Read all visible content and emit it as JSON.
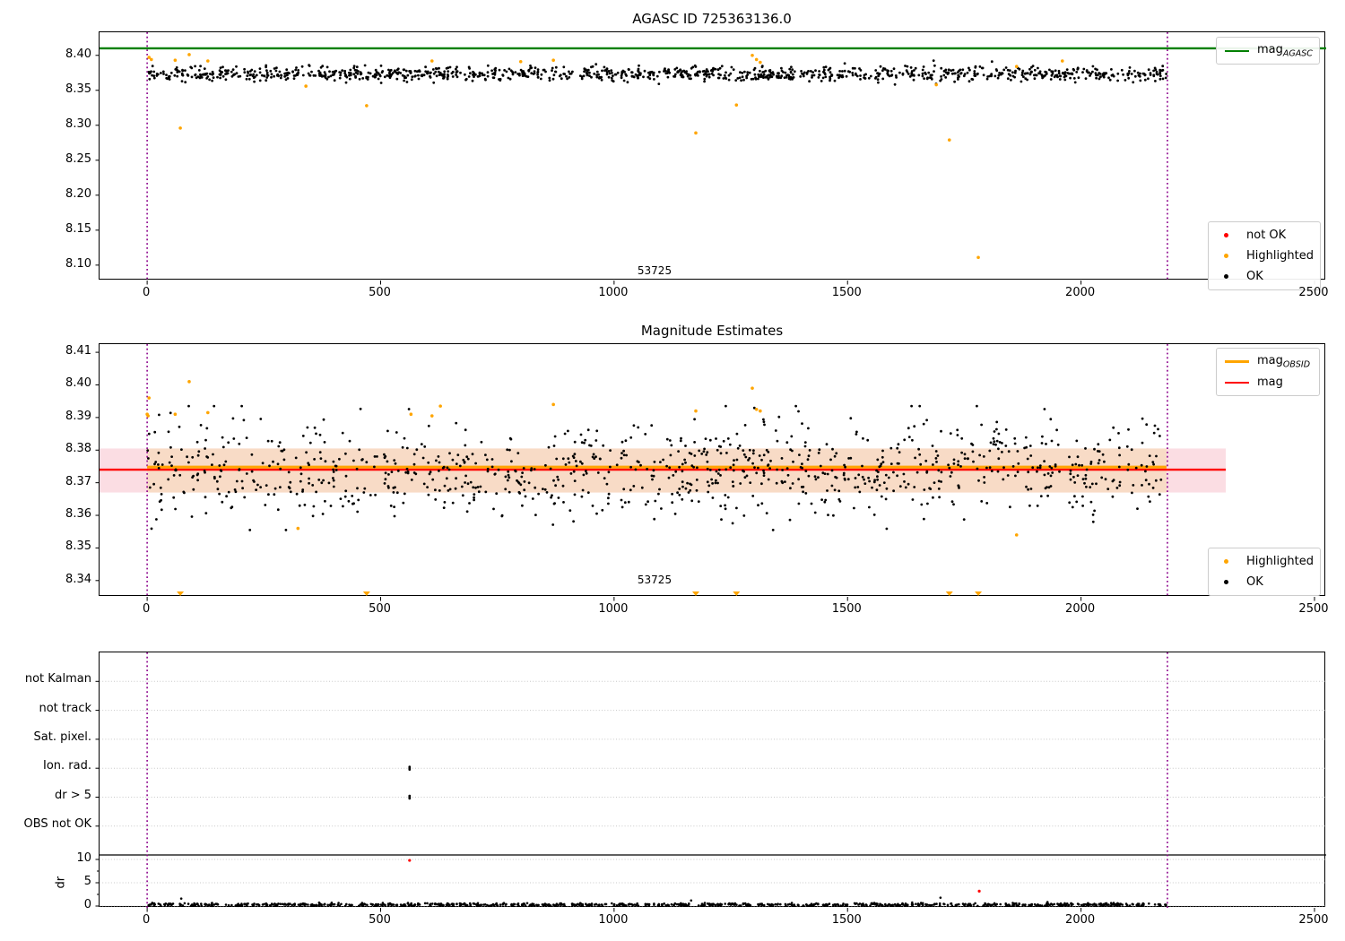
{
  "chart_data": [
    {
      "type": "scatter",
      "title": "AGASC ID 725363136.0",
      "xlim": [
        -102,
        2525
      ],
      "ylim": [
        8.078,
        8.433
      ],
      "xticks": [
        0,
        500,
        1000,
        1500,
        2000,
        2500
      ],
      "yticks": [
        "8.10",
        "8.15",
        "8.20",
        "8.25",
        "8.30",
        "8.35",
        "8.40"
      ],
      "grid": false,
      "agasc_line": {
        "value": 8.41,
        "color": "#008000",
        "label_main": "mag",
        "label_sub": "AGASC"
      },
      "obsid_window": {
        "start": 0,
        "end": 2185,
        "color": "#8B008B"
      },
      "ok": {
        "n": 1150,
        "x_start": 0,
        "x_end": 2183,
        "mean": 8.3735,
        "std": 0.0052,
        "clip_lo": 8.3565,
        "clip_hi": 8.3925,
        "color": "#000000",
        "seed": 42
      },
      "highlighted": {
        "color": "#FFA500",
        "points": [
          [
            4,
            8.397
          ],
          [
            9,
            8.394
          ],
          [
            60,
            8.393
          ],
          [
            90,
            8.401
          ],
          [
            130,
            8.392
          ],
          [
            71,
            8.296
          ],
          [
            340,
            8.356
          ],
          [
            470,
            8.328
          ],
          [
            610,
            8.392
          ],
          [
            800,
            8.391
          ],
          [
            870,
            8.393
          ],
          [
            1175,
            8.289
          ],
          [
            1262,
            8.329
          ],
          [
            1296,
            8.4
          ],
          [
            1305,
            8.394
          ],
          [
            1313,
            8.39
          ],
          [
            1690,
            8.358
          ],
          [
            1718,
            8.279
          ],
          [
            1780,
            8.111
          ],
          [
            1862,
            8.384
          ],
          [
            1960,
            8.392
          ]
        ]
      },
      "not_ok": {
        "color": "#FF0000",
        "points": []
      },
      "annotation": {
        "text": "53725",
        "x": 1089,
        "y": 8.088
      },
      "legend_markers": [
        {
          "label": "not OK",
          "color": "#FF0000"
        },
        {
          "label": "Highlighted",
          "color": "#FFA500"
        },
        {
          "label": "OK",
          "color": "#000000"
        }
      ]
    },
    {
      "type": "scatter",
      "title": "Magnitude Estimates",
      "xlim": [
        -102,
        2525
      ],
      "ylim": [
        8.335,
        8.4125
      ],
      "xticks": [
        0,
        500,
        1000,
        1500,
        2000,
        2500
      ],
      "yticks": [
        "8.34",
        "8.35",
        "8.36",
        "8.37",
        "8.38",
        "8.39",
        "8.40",
        "8.41"
      ],
      "band": {
        "lo": 8.367,
        "hi": 8.3805,
        "x_end": 2310,
        "outer_color": "#fbdde3",
        "inner_color": "#f8dbc6"
      },
      "mag_line": {
        "value": 8.374,
        "color": "#FF0000",
        "x_end": 2310,
        "label": "mag"
      },
      "obsid_line": {
        "value": 8.3748,
        "color": "#FFA500",
        "x_start": 0,
        "x_end": 2183,
        "label_main": "mag",
        "label_sub": "OBSID"
      },
      "obsid_window": {
        "start": 0,
        "end": 2185,
        "color": "#8B008B"
      },
      "ok": {
        "n": 1000,
        "x_start": 0,
        "x_end": 2183,
        "mean": 8.374,
        "std": 0.0072,
        "clip_lo": 8.3555,
        "clip_hi": 8.3935,
        "color": "#000000",
        "seed": 7
      },
      "highlighted": {
        "color": "#FFA500",
        "points": [
          [
            4,
            8.396
          ],
          [
            0,
            8.391
          ],
          [
            2,
            8.3905
          ],
          [
            60,
            8.391
          ],
          [
            90,
            8.401
          ],
          [
            130,
            8.3915
          ],
          [
            323,
            8.356
          ],
          [
            565,
            8.391
          ],
          [
            610,
            8.3905
          ],
          [
            628,
            8.3935
          ],
          [
            870,
            8.394
          ],
          [
            1175,
            8.392
          ],
          [
            1296,
            8.399
          ],
          [
            1305,
            8.3925
          ],
          [
            1313,
            8.392
          ],
          [
            1862,
            8.354
          ]
        ]
      },
      "clipped_low": {
        "color": "#FFA500",
        "xs": [
          71,
          470,
          1175,
          1262,
          1718,
          1780
        ]
      },
      "annotation": {
        "text": "53725",
        "x": 1089,
        "y": 8.3385
      },
      "legend_markers": [
        {
          "label": "Highlighted",
          "color": "#FFA500"
        },
        {
          "label": "OK",
          "color": "#000000"
        }
      ]
    },
    {
      "type": "flags-dr",
      "categories": [
        "not Kalman",
        "not track",
        "Sat. pixel.",
        "Ion. rad.",
        "dr > 5",
        "OBS not OK"
      ],
      "flag_points": [
        {
          "category": "Ion. rad.",
          "x": 562
        },
        {
          "category": "dr > 5",
          "x": 562
        }
      ],
      "dr": {
        "label": "dr",
        "ticks": [
          10,
          5,
          0
        ],
        "threshold_line": 10.9,
        "ok": {
          "n": 900,
          "x_start": 0,
          "x_end": 2183,
          "mean": 0.3,
          "std": 0.16,
          "seed": 11,
          "color": "#000000"
        },
        "outliers_black": [
          [
            73,
            1.6
          ],
          [
            1165,
            1.2
          ],
          [
            1699,
            1.8
          ]
        ],
        "outliers_red": [
          [
            562,
            9.8
          ],
          [
            1782,
            3.2
          ]
        ]
      },
      "obsid_window": {
        "start": 0,
        "end": 2185,
        "color": "#8B008B"
      },
      "xlim": [
        -102,
        2525
      ],
      "xticks": [
        0,
        500,
        1000,
        1500,
        2000,
        2500
      ],
      "grid_color": "#c8c8c8"
    }
  ]
}
